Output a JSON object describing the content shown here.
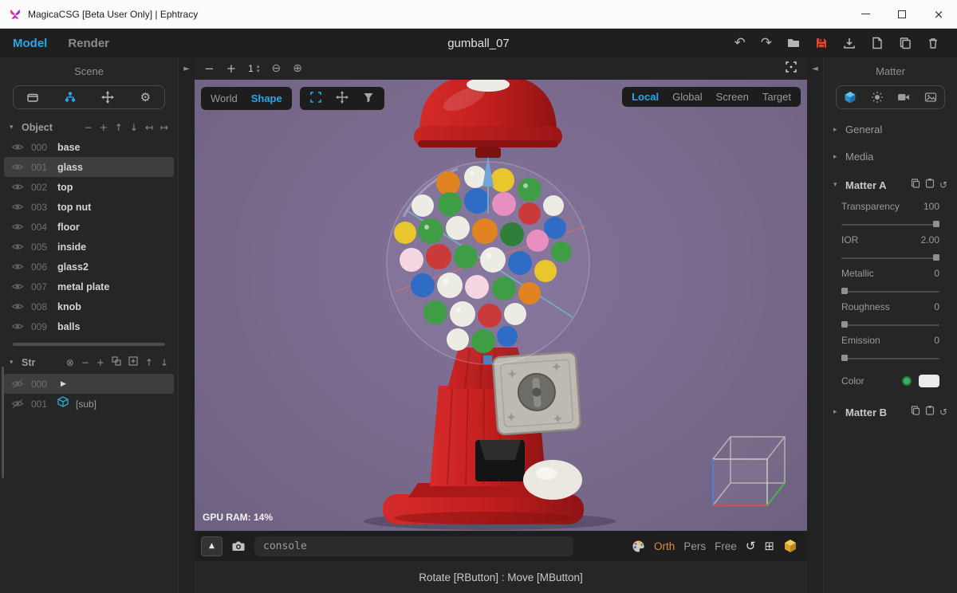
{
  "titlebar": {
    "app_title": "MagicaCSG [Beta User Only] | Ephtracy"
  },
  "toolbar": {
    "tabs": [
      {
        "label": "Model"
      },
      {
        "label": "Render"
      }
    ],
    "document_title": "gumball_07"
  },
  "scene": {
    "title": "Scene",
    "object_header": "Object",
    "objects": [
      {
        "id": "000",
        "name": "base"
      },
      {
        "id": "001",
        "name": "glass"
      },
      {
        "id": "002",
        "name": "top"
      },
      {
        "id": "003",
        "name": "top nut"
      },
      {
        "id": "004",
        "name": "floor"
      },
      {
        "id": "005",
        "name": "inside"
      },
      {
        "id": "006",
        "name": "glass2"
      },
      {
        "id": "007",
        "name": "metal plate"
      },
      {
        "id": "008",
        "name": "knob"
      },
      {
        "id": "009",
        "name": "balls"
      }
    ],
    "str_header": "Str",
    "str_items": [
      {
        "id": "000",
        "suffix": ""
      },
      {
        "id": "001",
        "suffix": "[sub]"
      }
    ]
  },
  "viewport": {
    "zoom_level": "1",
    "mode_tabs": [
      {
        "label": "World"
      },
      {
        "label": "Shape"
      }
    ],
    "axis_tabs": [
      {
        "label": "Local"
      },
      {
        "label": "Global"
      },
      {
        "label": "Screen"
      },
      {
        "label": "Target"
      }
    ],
    "gpu_ram": "GPU RAM: 14%",
    "console_placeholder": "console",
    "projection": [
      {
        "label": "Orth"
      },
      {
        "label": "Pers"
      },
      {
        "label": "Free"
      }
    ],
    "status_hint": "Rotate [RButton] : Move [MButton]"
  },
  "matter": {
    "title": "Matter",
    "sections": {
      "general": "General",
      "media": "Media",
      "matter_a": "Matter A",
      "matter_b": "Matter B"
    },
    "properties": [
      {
        "label": "Transparency",
        "value": "100",
        "pos": 100
      },
      {
        "label": "IOR",
        "value": "2.00",
        "pos": 100
      },
      {
        "label": "Metallic",
        "value": "0",
        "pos": 0
      },
      {
        "label": "Roughness",
        "value": "0",
        "pos": 0
      },
      {
        "label": "Emission",
        "value": "0",
        "pos": 0
      }
    ],
    "color_label": "Color"
  },
  "icons": {
    "close": "×",
    "undo": "↶",
    "redo": "↷",
    "collapse_left": "►",
    "collapse_right": "◄",
    "minus": "−",
    "plus": "+",
    "up": "↑",
    "down": "↓",
    "map_left": "↤",
    "map_right": "↦",
    "spin_up": "▴",
    "spin_down": "▾",
    "caret_down": "▾",
    "caret_right": "▸",
    "gear": "⚙",
    "circle_minus": "⊖",
    "circle_plus": "⊕",
    "circle_x": "⊗",
    "play": "▶",
    "triangle_up": "▲",
    "rotate": "↺",
    "quad": "⊞",
    "reset": "↺"
  },
  "colors": {
    "accent_blue": "#28a7e8",
    "accent_orange": "#d78f3c",
    "save_red": "#e2442e",
    "viewport_purple": "#796a8c",
    "machine_red": "#c31f1f"
  }
}
